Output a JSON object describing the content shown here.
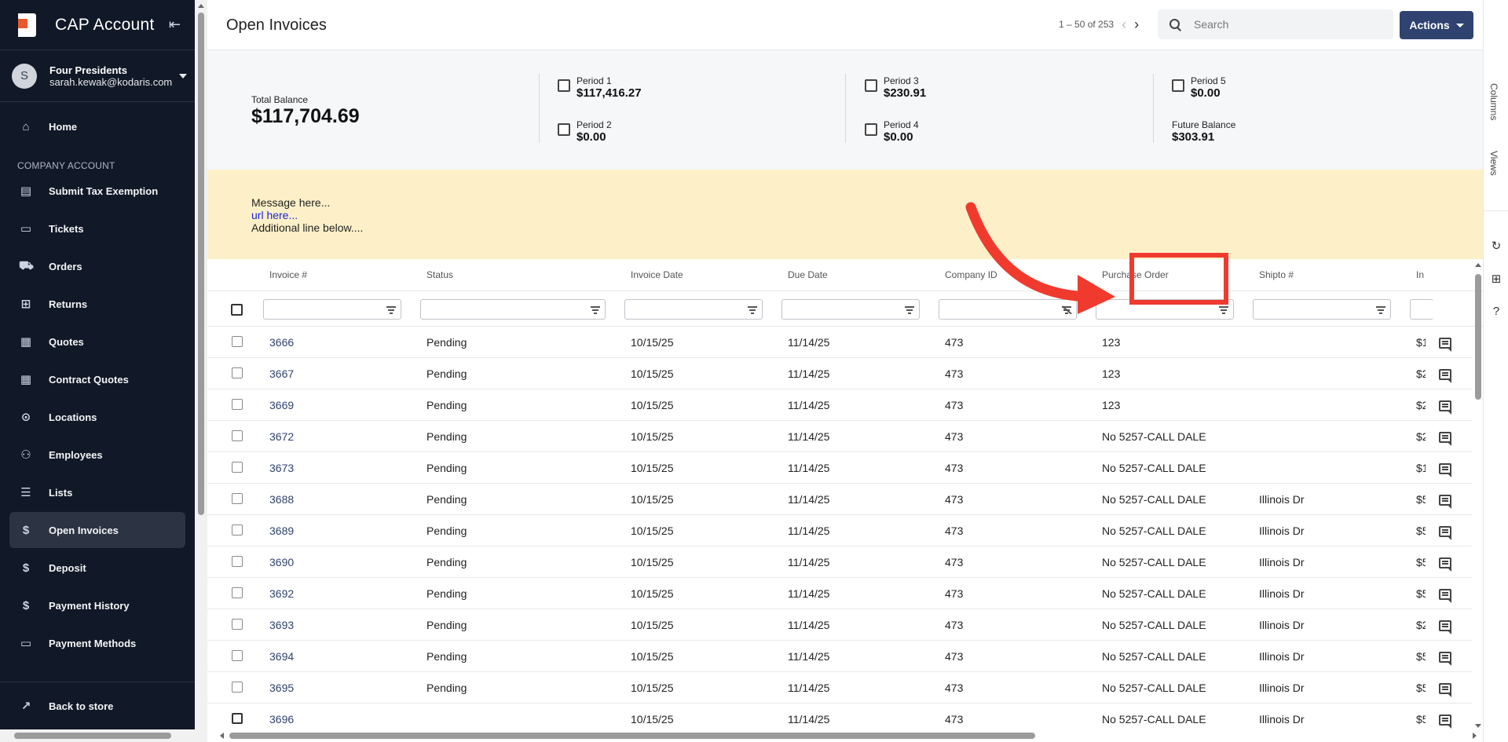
{
  "app": {
    "title": "CAP Account"
  },
  "user": {
    "initial": "S",
    "name": "Four Presidents",
    "email": "sarah.kewak@kodaris.com"
  },
  "nav": {
    "home": "Home",
    "section_label": "COMPANY ACCOUNT",
    "items": [
      {
        "label": "Submit Tax Exemption",
        "icon": "document-icon"
      },
      {
        "label": "Tickets",
        "icon": "ticket-icon"
      },
      {
        "label": "Orders",
        "icon": "truck-icon"
      },
      {
        "label": "Returns",
        "icon": "return-icon"
      },
      {
        "label": "Quotes",
        "icon": "clipboard-icon"
      },
      {
        "label": "Contract Quotes",
        "icon": "clipboard-icon"
      },
      {
        "label": "Locations",
        "icon": "location-pin-icon"
      },
      {
        "label": "Employees",
        "icon": "people-icon"
      },
      {
        "label": "Lists",
        "icon": "list-icon"
      },
      {
        "label": "Open Invoices",
        "icon": "dollar-icon"
      },
      {
        "label": "Deposit",
        "icon": "dollar-icon"
      },
      {
        "label": "Payment History",
        "icon": "dollar-icon"
      },
      {
        "label": "Payment Methods",
        "icon": "credit-card-icon"
      }
    ],
    "active": "Open Invoices",
    "back_to_store": "Back to store"
  },
  "header": {
    "page_title": "Open Invoices",
    "pagination": "1 – 50 of 253",
    "search_placeholder": "Search",
    "actions_label": "Actions"
  },
  "summary": {
    "total_label": "Total Balance",
    "total_value": "$117,704.69",
    "periods": [
      {
        "label": "Period 1",
        "value": "$117,416.27"
      },
      {
        "label": "Period 2",
        "value": "$0.00"
      },
      {
        "label": "Period 3",
        "value": "$230.91"
      },
      {
        "label": "Period 4",
        "value": "$0.00"
      },
      {
        "label": "Period 5",
        "value": "$0.00"
      }
    ],
    "future_label": "Future Balance",
    "future_value": "$303.91"
  },
  "message": {
    "line1": "Message here...",
    "link": "url here...",
    "line3": "Additional line below...."
  },
  "right_panel": {
    "columns_tab": "Columns",
    "views_tab": "Views"
  },
  "table": {
    "columns": [
      "Invoice #",
      "Status",
      "Invoice Date",
      "Due Date",
      "Company ID",
      "Purchase Order",
      "Shipto #",
      "In"
    ],
    "rows": [
      {
        "invoice": "3666",
        "status": "Pending",
        "invoice_date": "10/15/25",
        "due_date": "11/14/25",
        "company_id": "473",
        "po": "123",
        "shipto": "",
        "amount": "$1"
      },
      {
        "invoice": "3667",
        "status": "Pending",
        "invoice_date": "10/15/25",
        "due_date": "11/14/25",
        "company_id": "473",
        "po": "123",
        "shipto": "",
        "amount": "$2"
      },
      {
        "invoice": "3669",
        "status": "Pending",
        "invoice_date": "10/15/25",
        "due_date": "11/14/25",
        "company_id": "473",
        "po": "123",
        "shipto": "",
        "amount": "$2"
      },
      {
        "invoice": "3672",
        "status": "Pending",
        "invoice_date": "10/15/25",
        "due_date": "11/14/25",
        "company_id": "473",
        "po": "No 5257-CALL DALE",
        "shipto": "",
        "amount": "$2"
      },
      {
        "invoice": "3673",
        "status": "Pending",
        "invoice_date": "10/15/25",
        "due_date": "11/14/25",
        "company_id": "473",
        "po": "No 5257-CALL DALE",
        "shipto": "",
        "amount": "$1"
      },
      {
        "invoice": "3688",
        "status": "Pending",
        "invoice_date": "10/15/25",
        "due_date": "11/14/25",
        "company_id": "473",
        "po": "No 5257-CALL DALE",
        "shipto": "Illinois Dr",
        "amount": "$5"
      },
      {
        "invoice": "3689",
        "status": "Pending",
        "invoice_date": "10/15/25",
        "due_date": "11/14/25",
        "company_id": "473",
        "po": "No 5257-CALL DALE",
        "shipto": "Illinois Dr",
        "amount": "$5"
      },
      {
        "invoice": "3690",
        "status": "Pending",
        "invoice_date": "10/15/25",
        "due_date": "11/14/25",
        "company_id": "473",
        "po": "No 5257-CALL DALE",
        "shipto": "Illinois Dr",
        "amount": "$5"
      },
      {
        "invoice": "3692",
        "status": "Pending",
        "invoice_date": "10/15/25",
        "due_date": "11/14/25",
        "company_id": "473",
        "po": "No 5257-CALL DALE",
        "shipto": "Illinois Dr",
        "amount": "$5"
      },
      {
        "invoice": "3693",
        "status": "Pending",
        "invoice_date": "10/15/25",
        "due_date": "11/14/25",
        "company_id": "473",
        "po": "No 5257-CALL DALE",
        "shipto": "Illinois Dr",
        "amount": "$2"
      },
      {
        "invoice": "3694",
        "status": "Pending",
        "invoice_date": "10/15/25",
        "due_date": "11/14/25",
        "company_id": "473",
        "po": "No 5257-CALL DALE",
        "shipto": "Illinois Dr",
        "amount": "$5"
      },
      {
        "invoice": "3695",
        "status": "Pending",
        "invoice_date": "10/15/25",
        "due_date": "11/14/25",
        "company_id": "473",
        "po": "No 5257-CALL DALE",
        "shipto": "Illinois Dr",
        "amount": "$5"
      },
      {
        "invoice": "3696",
        "status": "",
        "invoice_date": "10/15/25",
        "due_date": "11/14/25",
        "company_id": "473",
        "po": "No 5257-CALL DALE",
        "shipto": "Illinois Dr",
        "amount": "$5"
      }
    ]
  },
  "colors": {
    "sidebar_bg": "#111827",
    "accent": "#2f4270",
    "message_bg": "#fdf0c8",
    "annotation": "#f03a2e"
  }
}
